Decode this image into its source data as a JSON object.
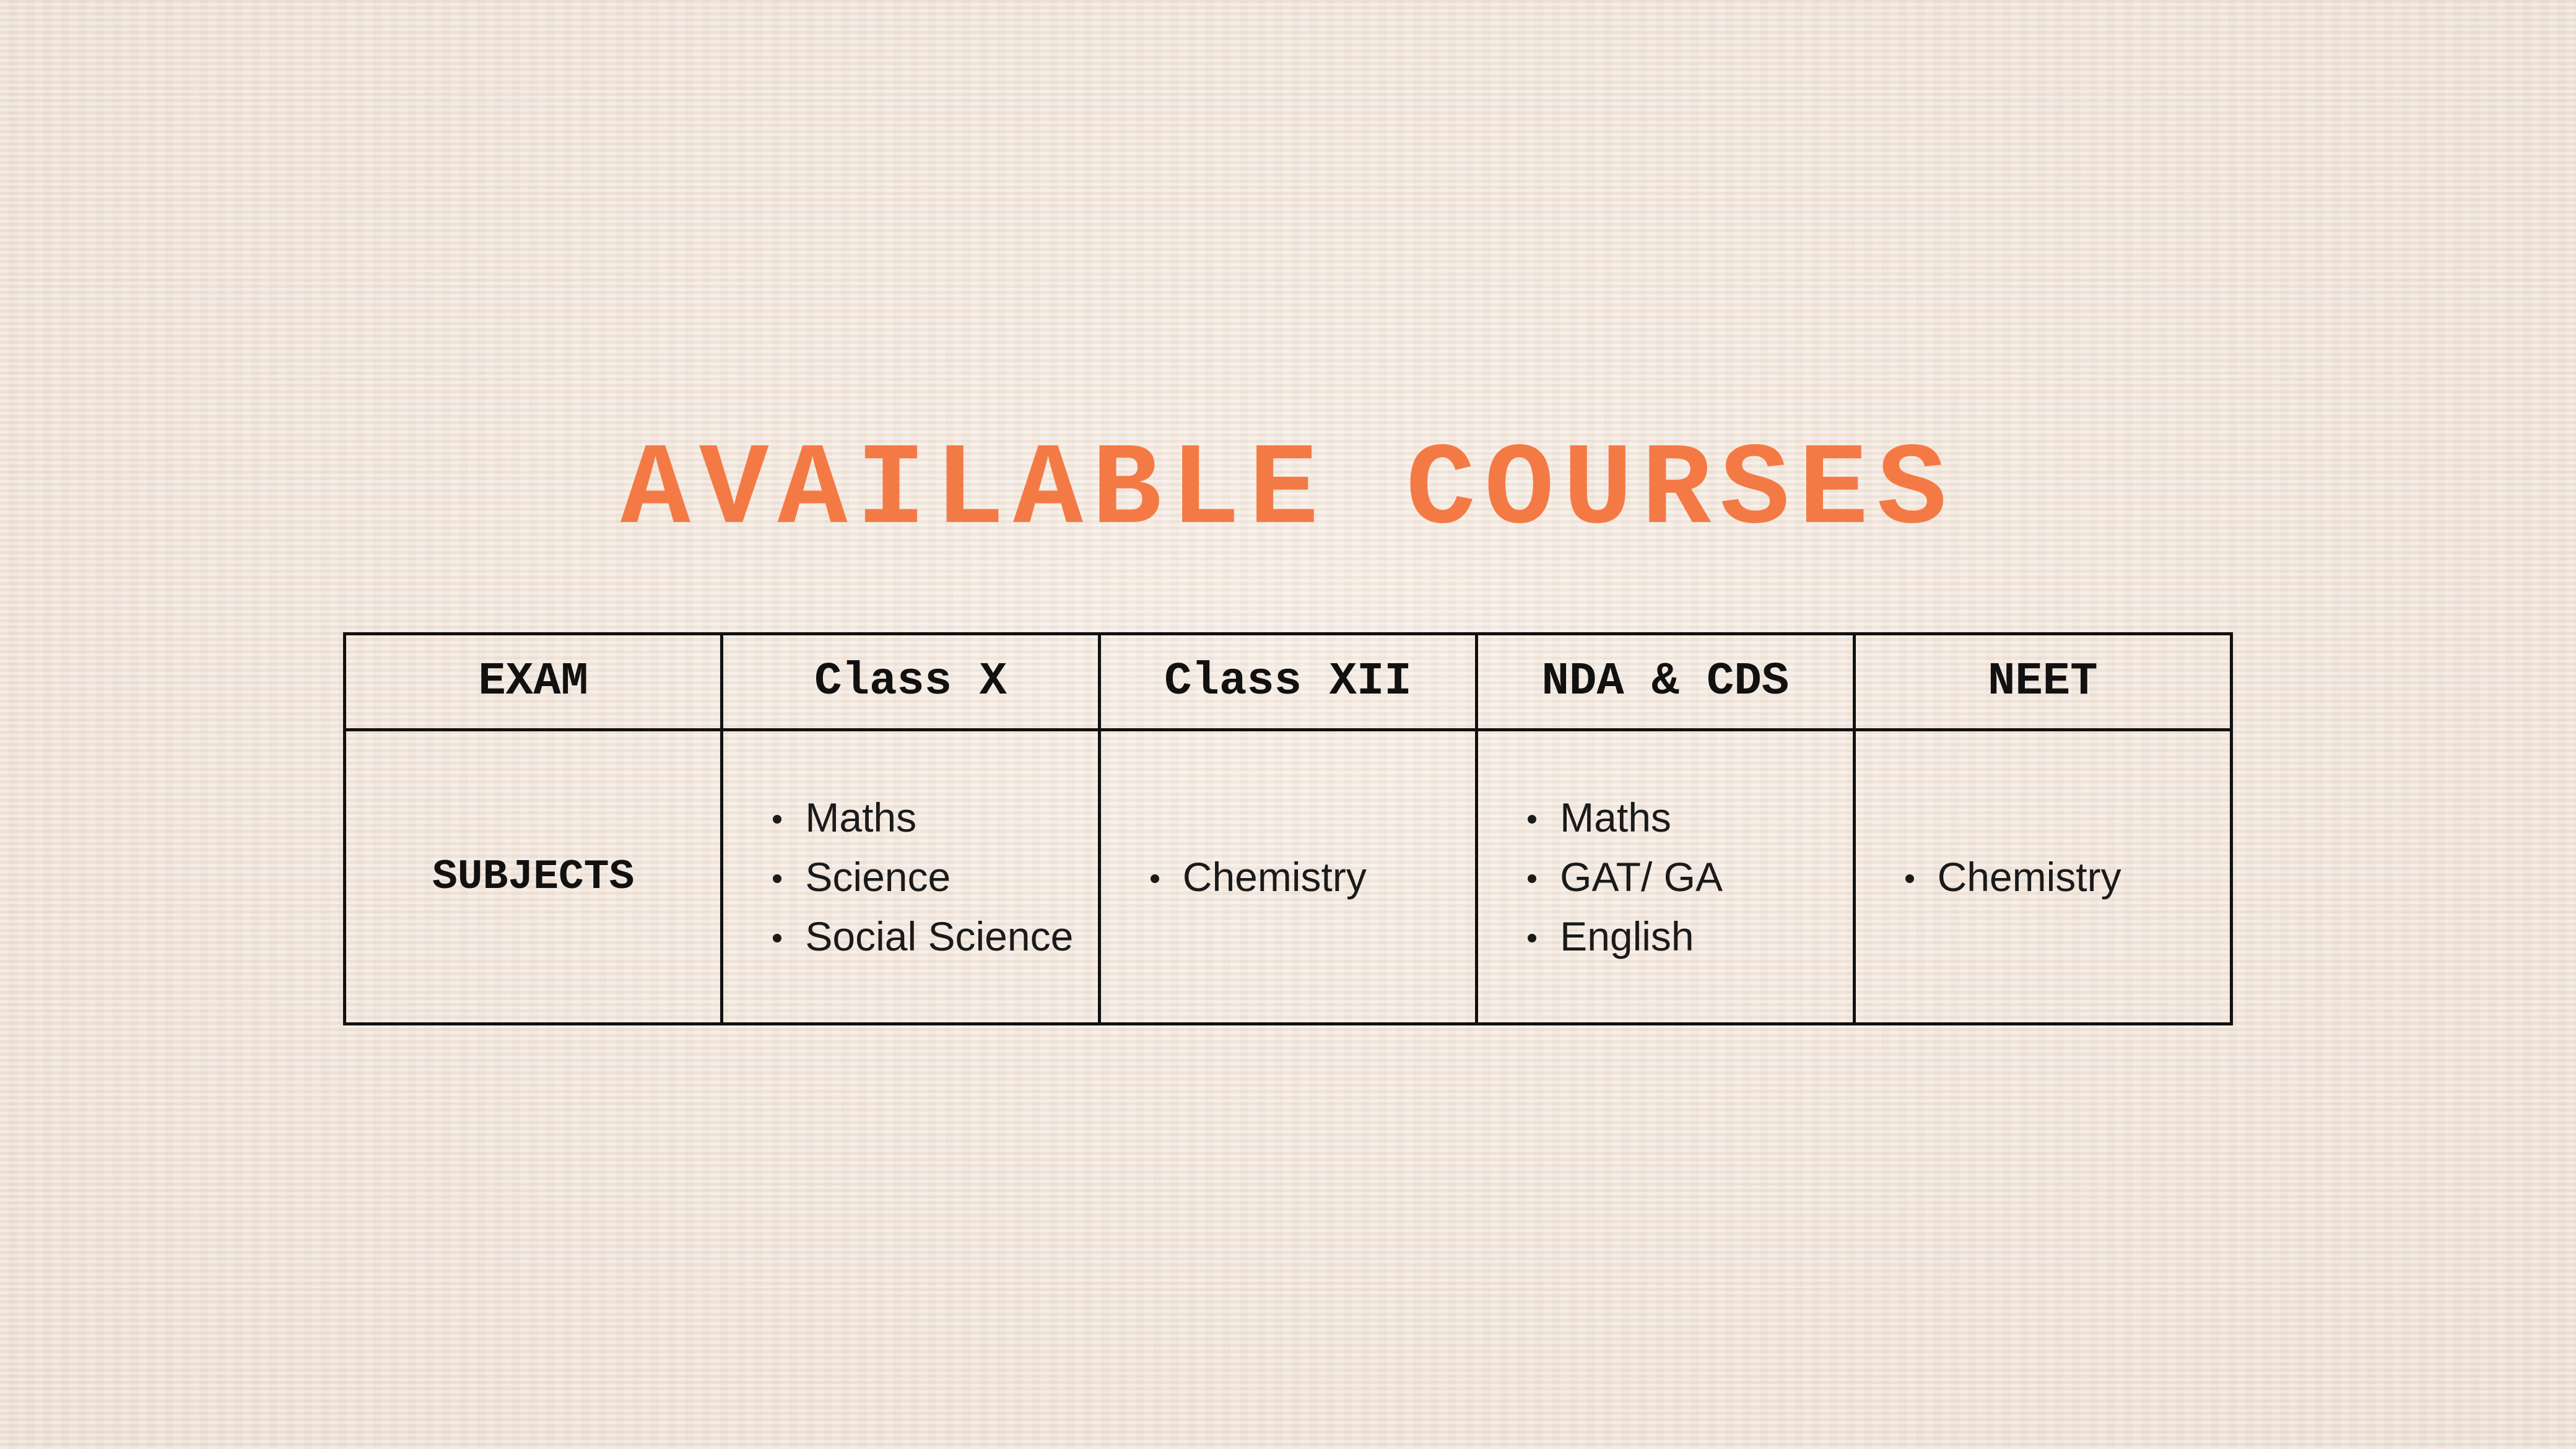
{
  "title": "AVAILABLE COURSES",
  "colors": {
    "accent": "#f47a45",
    "text": "#111111",
    "background": "#f6ebe2"
  },
  "table": {
    "headers": [
      "EXAM",
      "Class X",
      "Class XII",
      "NDA & CDS",
      "NEET"
    ],
    "row_label": "SUBJECTS",
    "subjects": {
      "class_x": [
        "Maths",
        "Science",
        "Social Science"
      ],
      "class_xii": [
        "Chemistry"
      ],
      "nda_cds": [
        "Maths",
        "GAT/ GA",
        "English"
      ],
      "neet": [
        "Chemistry"
      ]
    }
  }
}
